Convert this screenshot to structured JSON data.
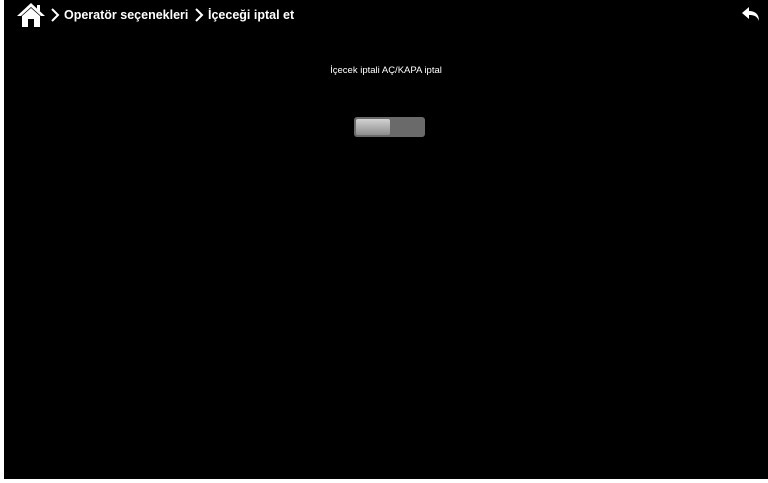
{
  "header": {
    "home_icon": "home-icon",
    "breadcrumbs": [
      {
        "label": "Operatör seçenekleri"
      },
      {
        "label": "İçeceği iptal et"
      }
    ],
    "back_icon": "back-arrow-icon"
  },
  "setting": {
    "label": "İçecek iptali AÇ/KAPA iptal",
    "toggle_state": "off"
  },
  "colors": {
    "background": "#000000",
    "text": "#ffffff",
    "toggle_track": "#6a6a6a",
    "toggle_thumb": "#b0b0b0"
  }
}
